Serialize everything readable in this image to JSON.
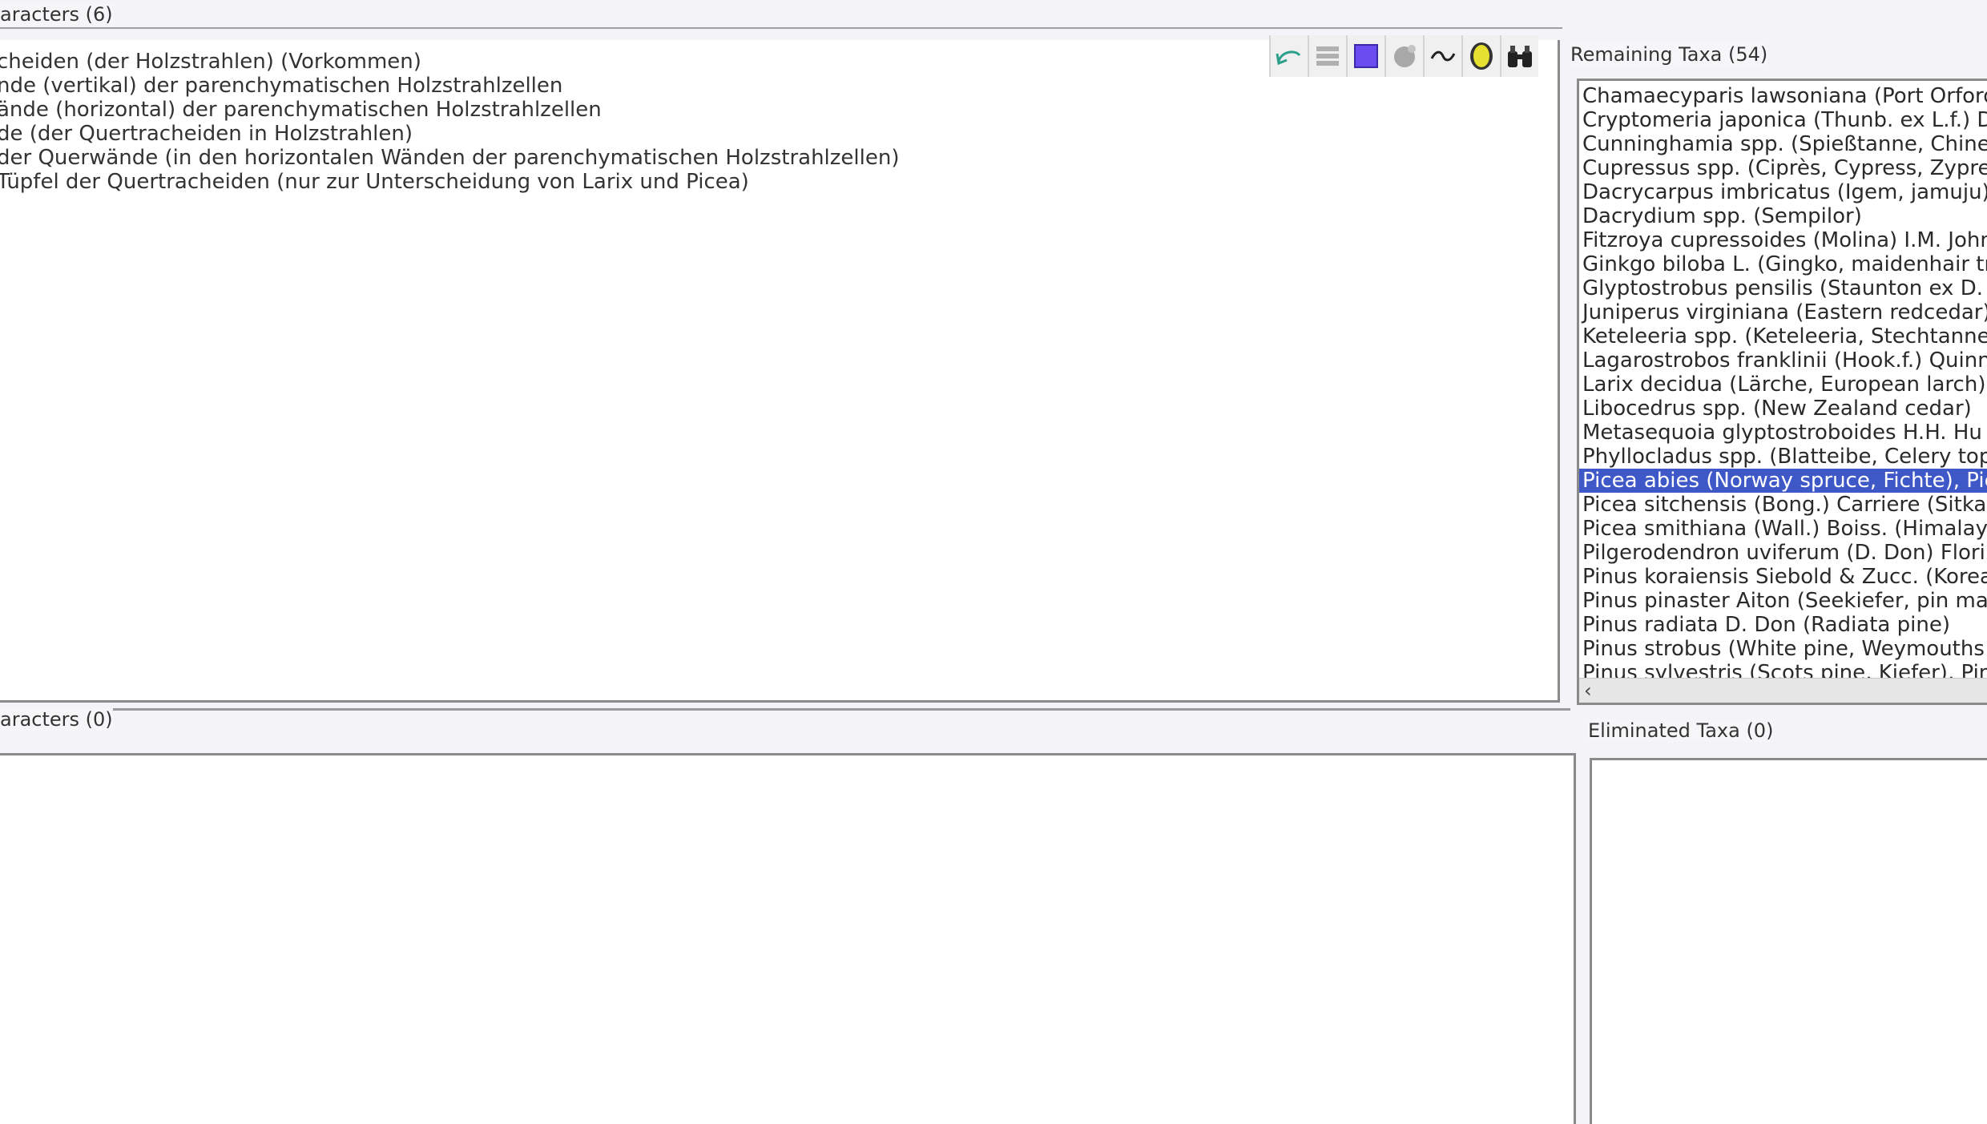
{
  "used_characters": {
    "header": "aracters (6)",
    "items": [
      "cheiden (der Holzstrahlen) (Vorkommen)",
      "nde (vertikal) der parenchymatischen Holzstrahlzellen",
      "ände (horizontal) der parenchymatischen Holzstrahlzellen",
      "de (der Quertracheiden in Holzstrahlen)",
      "der Querwände (in den horizontalen Wänden der parenchymatischen Holzstrahlzellen)",
      " Tüpfel der Quertracheiden (nur zur Unterscheidung von Larix und Picea)"
    ]
  },
  "toolbar": {
    "icons": [
      "undo-icon",
      "list-icon",
      "square-icon",
      "sphere-icon",
      "tilde-icon",
      "ellipse-icon",
      "binoculars-icon"
    ],
    "colors": {
      "square": "#6a4cf0",
      "ellipse_fill": "#e6e030",
      "sphere": "#a8a8a8"
    }
  },
  "remaining_taxa": {
    "header": "Remaining Taxa (54)",
    "selected_index": 16,
    "items": [
      "Chamaecyparis lawsoniana (Port Orford ced",
      "Cryptomeria japonica (Thunb. ex L.f.) D. Dor",
      "Cunninghamia spp. (Spießtanne, Chinese fi",
      "Cupressus spp. (Ciprès, Cypress, Zypresse",
      "Dacrycarpus imbricatus (Igem, jamuju), Dac",
      "Dacrydium spp. (Sempilor)",
      "Fitzroya cupressoides (Molina) I.M. Johnst",
      "Ginkgo biloba L. (Gingko, maidenhair tree)",
      "Glyptostrobus pensilis (Staunton ex D. Dor",
      "Juniperus virginiana (Eastern redcedar), Ju",
      "Keteleeria spp. (Keteleeria, Stechtanne)",
      "Lagarostrobos franklinii (Hook.f.) Quinn (Hu",
      "Larix decidua (Lärche, European larch), La",
      "Libocedrus spp. (New Zealand cedar)",
      "Metasequoia glyptostroboides H.H. Hu & V",
      "Phyllocladus spp. (Blatteibe, Celery top pi",
      "Picea abies (Norway spruce, Fichte), Picea",
      "Picea sitchensis (Bong.) Carriere (Sitkafich",
      "Picea smithiana (Wall.) Boiss. (Himalaya",
      "Pilgerodendron uviferum (D. Don) Florin (",
      "Pinus koraiensis Siebold & Zucc. (Korea K",
      "Pinus pinaster Aiton (Seekiefer, pin mariti",
      "Pinus radiata D. Don (Radiata pine)",
      "Pinus strobus (White pine, Weymouths K",
      "Pinus sylvestris (Scots pine, Kiefer), Pinu"
    ],
    "scroll_left_arrow": "‹"
  },
  "unused_characters": {
    "header": "aracters (0)"
  },
  "eliminated_taxa": {
    "header": "Eliminated Taxa (0)"
  }
}
